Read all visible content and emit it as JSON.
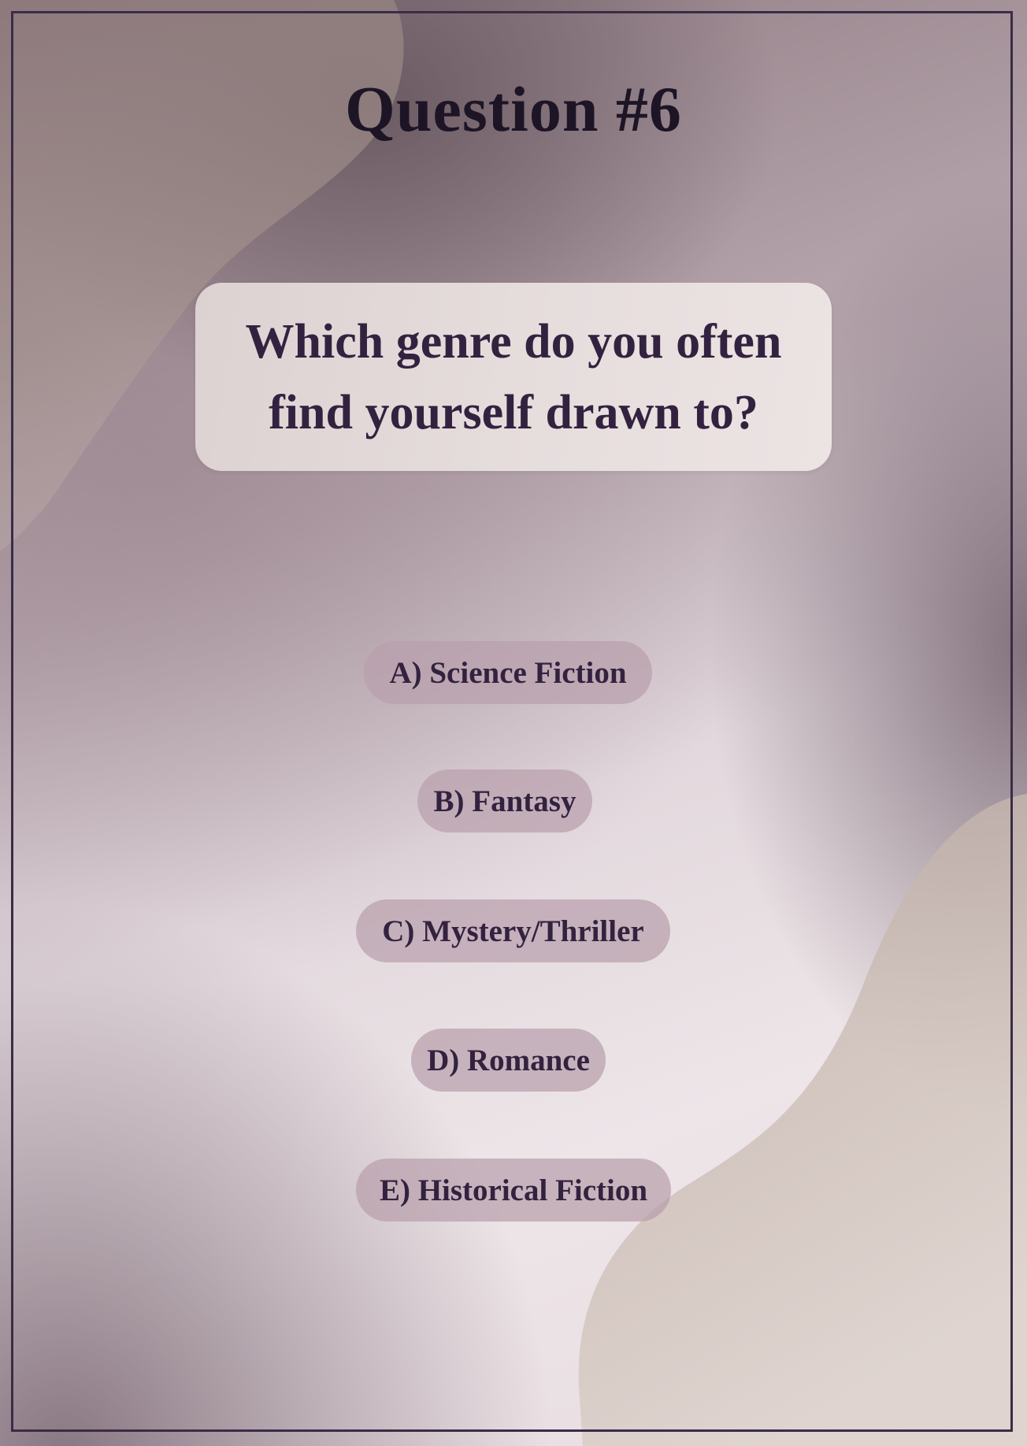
{
  "title": "Question #6",
  "question": "Which genre do you often find yourself drawn to?",
  "options": [
    {
      "label": "A) Science Fiction"
    },
    {
      "label": "B) Fantasy"
    },
    {
      "label": "C) Mystery/Thriller"
    },
    {
      "label": "D) Romance"
    },
    {
      "label": "E) Historical Fiction"
    }
  ],
  "colors": {
    "frame": "#3a2c48",
    "title_text": "#1d1526",
    "question_text": "#33223f",
    "question_card": "#e4dbda",
    "option_pill": "#bda8b3",
    "background_light": "#ede5e8",
    "background_dark": "#8b767d"
  }
}
